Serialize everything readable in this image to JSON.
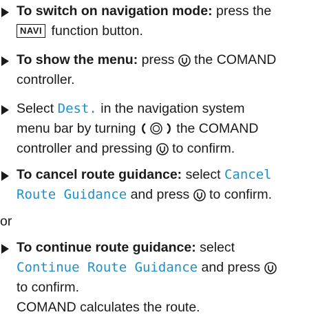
{
  "s1": {
    "bold": "To switch on navigation mode:",
    "t1": " press the",
    "key": "NAVI",
    "t2": "function button."
  },
  "s2": {
    "bold": "To show the menu:",
    "t1": " press",
    "t2": " the COMAND",
    "t3": "controller."
  },
  "s3": {
    "t1": "Select ",
    "mono": "Dest.",
    "t2": " in the navigation system",
    "t3": "menu bar by turning ",
    "t4": " the COMAND",
    "t5": "controller and pressing ",
    "t6": " to confirm."
  },
  "s4": {
    "bold": "To cancel route guidance:",
    "t1": " select ",
    "mono1": "Cancel",
    "mono2": "Route Guidance",
    "t2": " and press ",
    "t3": " to confirm."
  },
  "or": "or",
  "s5": {
    "bold": "To continue route guidance:",
    "t1": " select",
    "mono": "Continue Route Guidance",
    "t2": " and press ",
    "t3": "to confirm.",
    "t4": "COMAND calculates the route."
  },
  "icons": [
    "press-controller-icon",
    "turn-controller-icon"
  ]
}
